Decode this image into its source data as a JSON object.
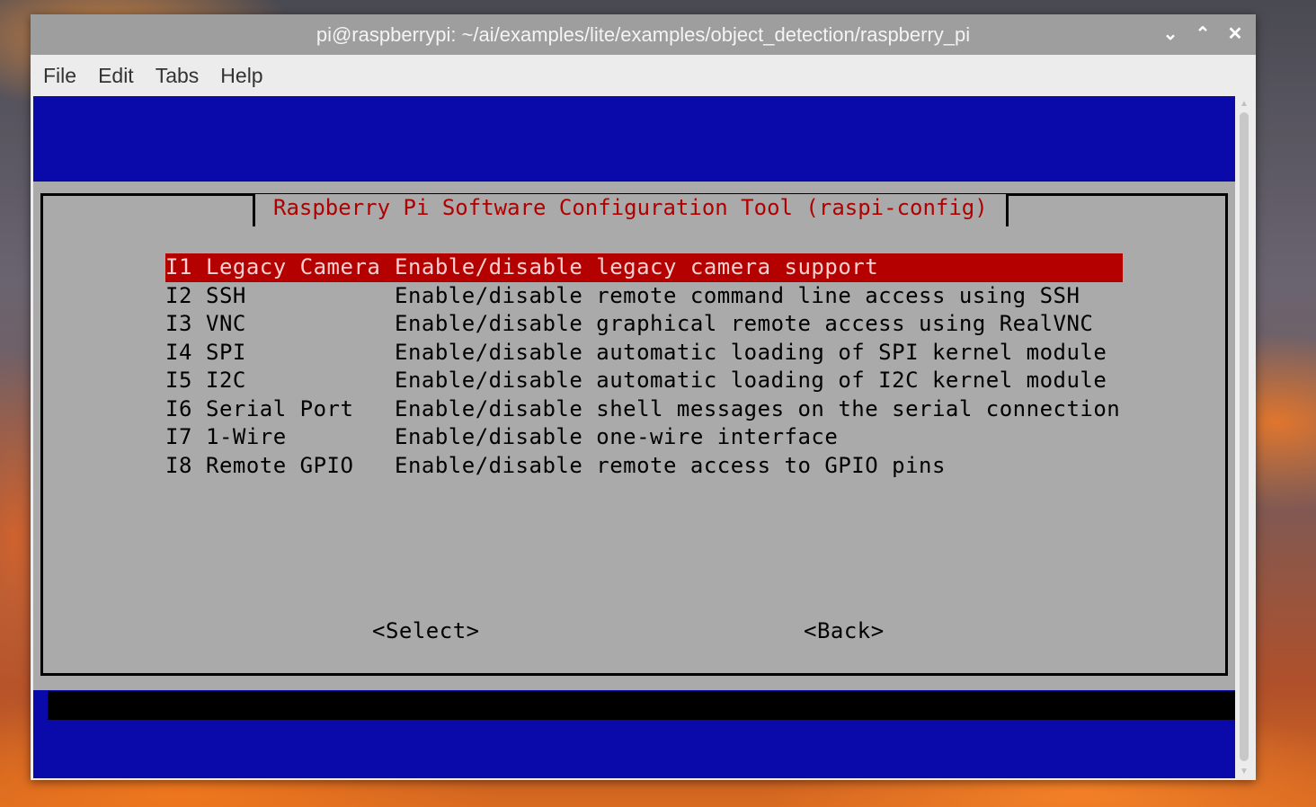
{
  "window": {
    "title": "pi@raspberrypi: ~/ai/examples/lite/examples/object_detection/raspberry_pi",
    "controls": {
      "minimize": "⌄",
      "maximize": "⌃",
      "close": "✕"
    }
  },
  "menubar": {
    "items": [
      "File",
      "Edit",
      "Tabs",
      "Help"
    ]
  },
  "dialog": {
    "title": "Raspberry Pi Software Configuration Tool (raspi-config)",
    "items": [
      {
        "code": "I1",
        "name": "Legacy Camera",
        "desc": "Enable/disable legacy camera support",
        "selected": true
      },
      {
        "code": "I2",
        "name": "SSH",
        "desc": "Enable/disable remote command line access using SSH"
      },
      {
        "code": "I3",
        "name": "VNC",
        "desc": "Enable/disable graphical remote access using RealVNC"
      },
      {
        "code": "I4",
        "name": "SPI",
        "desc": "Enable/disable automatic loading of SPI kernel module"
      },
      {
        "code": "I5",
        "name": "I2C",
        "desc": "Enable/disable automatic loading of I2C kernel module"
      },
      {
        "code": "I6",
        "name": "Serial Port",
        "desc": "Enable/disable shell messages on the serial connection"
      },
      {
        "code": "I7",
        "name": "1-Wire",
        "desc": "Enable/disable one-wire interface"
      },
      {
        "code": "I8",
        "name": "Remote GPIO",
        "desc": "Enable/disable remote access to GPIO pins"
      }
    ],
    "select_label": "<Select>",
    "back_label": "<Back>"
  },
  "colors": {
    "terminal_bg": "#0a0aab",
    "dialog_bg": "#aaaaaa",
    "title_text": "#b00000",
    "highlight": "#b50000"
  }
}
